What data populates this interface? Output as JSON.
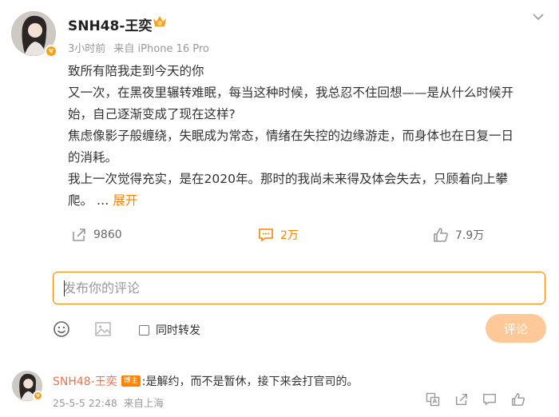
{
  "post": {
    "username": "SNH48-王奕",
    "time": "3小时前",
    "source": "来自 iPhone 16 Pro",
    "lines": [
      "致所有陪我走到今天的你",
      "又一次，在黑夜里辗转难眠，每当这种时候，我总忍不住回想——是从什么时候开",
      "始，自己逐渐变成了现在这样?",
      "焦虑像影子般缠绕，失眠成为常态，情绪在失控的边缘游走，而身体也在日复一日",
      "的消耗。",
      "我上一次觉得充实，是在2020年。那时的我尚未来得及体会失去，只顾着向上攀",
      "爬。 …"
    ],
    "expand_label": "展开",
    "repost_count": "9860",
    "comment_count": "2万",
    "like_count": "7.9万"
  },
  "composer": {
    "placeholder": "发布你的评论",
    "repost_label": "同时转发",
    "submit_label": "评论"
  },
  "comment": {
    "username": "SNH48-王奕",
    "badge": "博主",
    "text": ":是解约，而不是暂休，接下来会打官司的。",
    "time": "25-5-5 22:48",
    "location": "来自上海"
  },
  "colors": {
    "accent": "#ff8200",
    "comment_user": "#eb7350",
    "submit_disabled": "#ffc898"
  }
}
